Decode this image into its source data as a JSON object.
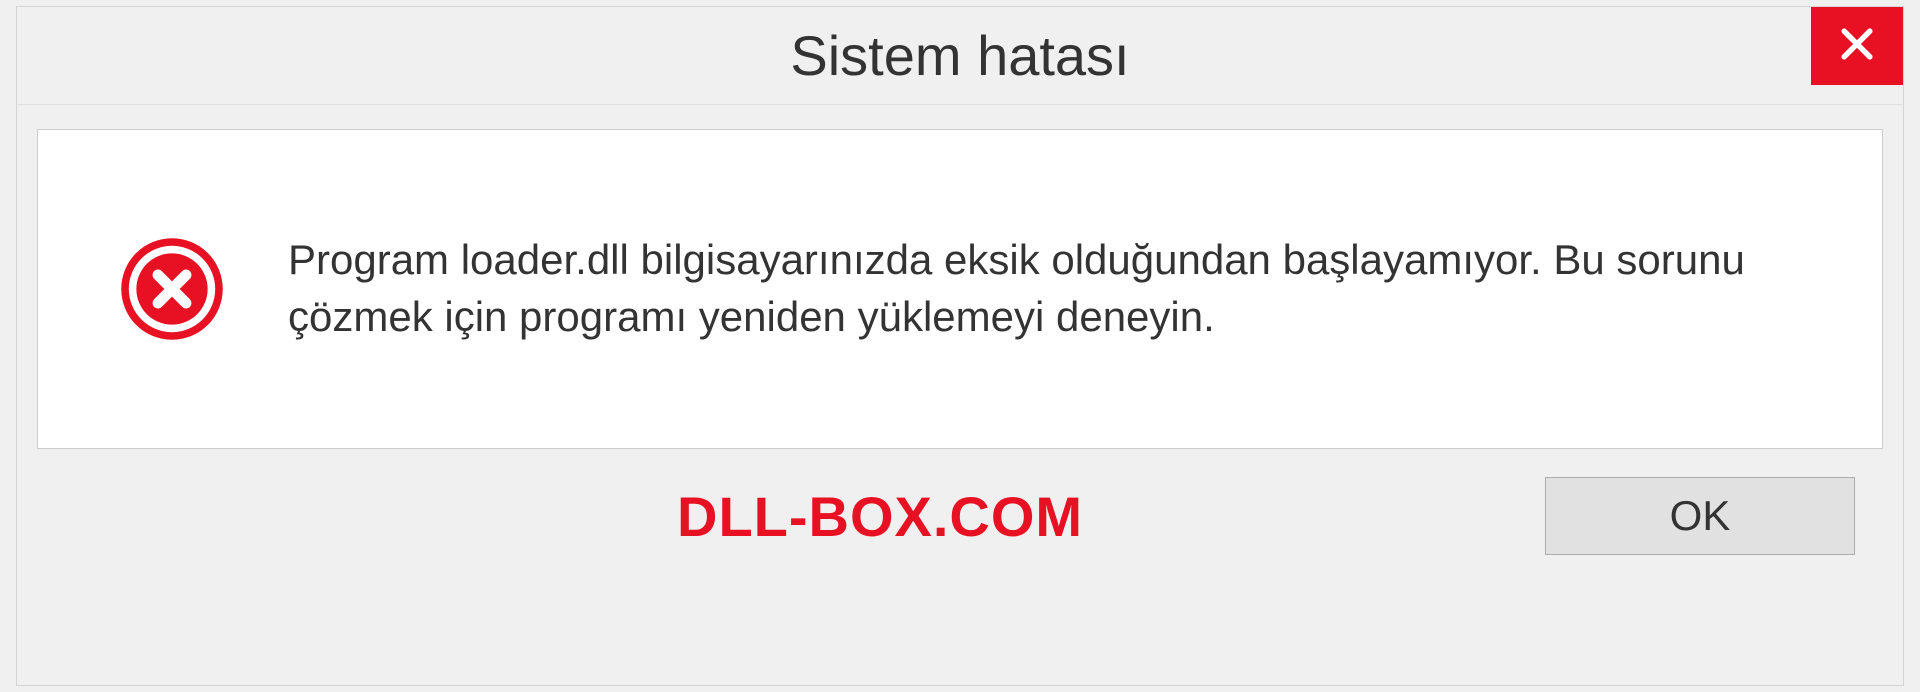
{
  "dialog": {
    "title": "Sistem hatası",
    "message": "Program loader.dll bilgisayarınızda eksik olduğundan başlayamıyor. Bu sorunu çözmek için programı yeniden yüklemeyi deneyin.",
    "ok_label": "OK"
  },
  "watermark": "DLL-BOX.COM"
}
